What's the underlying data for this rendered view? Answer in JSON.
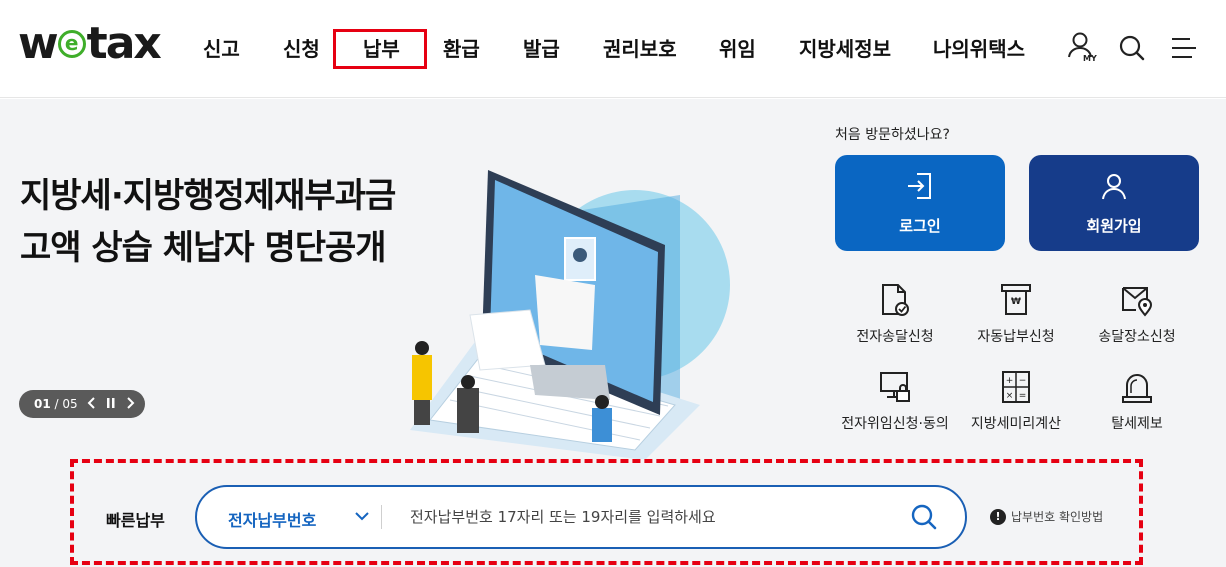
{
  "brand": {
    "logo_pre": "w",
    "logo_e": "e",
    "logo_post": "tax"
  },
  "nav": [
    {
      "label": "신고"
    },
    {
      "label": "신청"
    },
    {
      "label": "납부"
    },
    {
      "label": "환급"
    },
    {
      "label": "발급"
    },
    {
      "label": "권리보호"
    },
    {
      "label": "위임"
    },
    {
      "label": "지방세정보"
    },
    {
      "label": "나의위택스"
    }
  ],
  "header_icons": {
    "my_label": "MY"
  },
  "hero": {
    "title_line1": "지방세·지방행정제재부과금",
    "title_line2": "고액 상습 체납자 명단공개",
    "slide_current": "01",
    "slide_total": "/ 05"
  },
  "side": {
    "first_visit": "처음 방문하셨나요?",
    "login": "로그인",
    "signup": "회원가입",
    "quick_links": [
      {
        "label": "전자송달신청",
        "icon": "document-check-icon"
      },
      {
        "label": "자동납부신청",
        "icon": "auto-payment-icon"
      },
      {
        "label": "송달장소신청",
        "icon": "location-envelope-icon"
      },
      {
        "label": "전자위임신청·동의",
        "icon": "computer-lock-icon"
      },
      {
        "label": "지방세미리계산",
        "icon": "calculator-icon"
      },
      {
        "label": "탈세제보",
        "icon": "siren-icon"
      }
    ]
  },
  "quickpay": {
    "label": "빠른납부",
    "select_value": "전자납부번호",
    "placeholder": "전자납부번호 17자리 또는 19자리를 입력하세요",
    "help": "납부번호 확인방법"
  },
  "colors": {
    "primary_blue": "#0a66c2",
    "navy": "#163c8a",
    "highlight_red": "#e60012",
    "logo_green": "#3fae2a"
  }
}
